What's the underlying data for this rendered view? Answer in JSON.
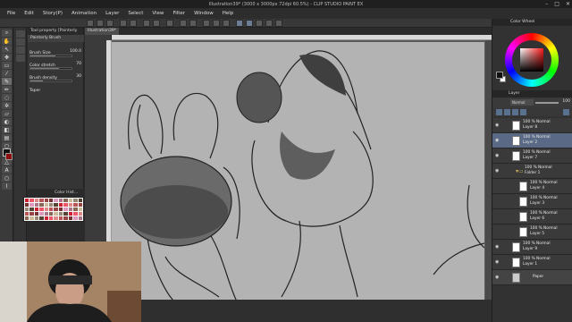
{
  "title": "Illustration39* (3000 x 3000px 72dpi 60.5%) - CLIP STUDIO PAINT EX",
  "menu": [
    "File",
    "Edit",
    "Story(P)",
    "Animation",
    "Layer",
    "Select",
    "View",
    "Filter",
    "Window",
    "Help"
  ],
  "tool_property": {
    "header": "Tool property [Painterly Br...",
    "tab": "Painterly Brush",
    "rows": [
      {
        "label": "Brush Size",
        "value": "100.0",
        "level": 0.6
      },
      {
        "label": "Color stretch",
        "value": "70",
        "level": 0.7
      },
      {
        "label": "Brush density",
        "value": "30",
        "level": 0.3
      },
      {
        "label": "Taper",
        "value": "",
        "level": 0.0
      }
    ]
  },
  "color_history_label": "Color Hist...",
  "canvas_tab": "Illustration39*",
  "color_wheel_label": "Color Wheel",
  "layer_panel": {
    "label": "Layer",
    "blend": "Normal",
    "opacity": "100",
    "layers": [
      {
        "line1": "100 % Normal",
        "line2": "Layer 8",
        "selected": false
      },
      {
        "line1": "100 % Normal",
        "line2": "Layer 2",
        "selected": true
      },
      {
        "line1": "100 % Normal",
        "line2": "Layer 7",
        "selected": false
      },
      {
        "line1": "100 % Normal",
        "line2": "Folder 1",
        "selected": false
      },
      {
        "line1": "100 % Normal",
        "line2": "Layer 4",
        "selected": false
      },
      {
        "line1": "100 % Normal",
        "line2": "Layer 3",
        "selected": false
      },
      {
        "line1": "100 % Normal",
        "line2": "Layer 6",
        "selected": false
      },
      {
        "line1": "100 % Normal",
        "line2": "Layer 5",
        "selected": false
      },
      {
        "line1": "100 % Normal",
        "line2": "Layer 9",
        "selected": false
      },
      {
        "line1": "100 % Normal",
        "line2": "Layer 1",
        "selected": false
      },
      {
        "line1": "Paper",
        "line2": "",
        "selected": false
      }
    ]
  },
  "colors": {
    "main_color": "#111111",
    "sub_color": "#ffffff",
    "canvas": "#b3b3b3"
  }
}
